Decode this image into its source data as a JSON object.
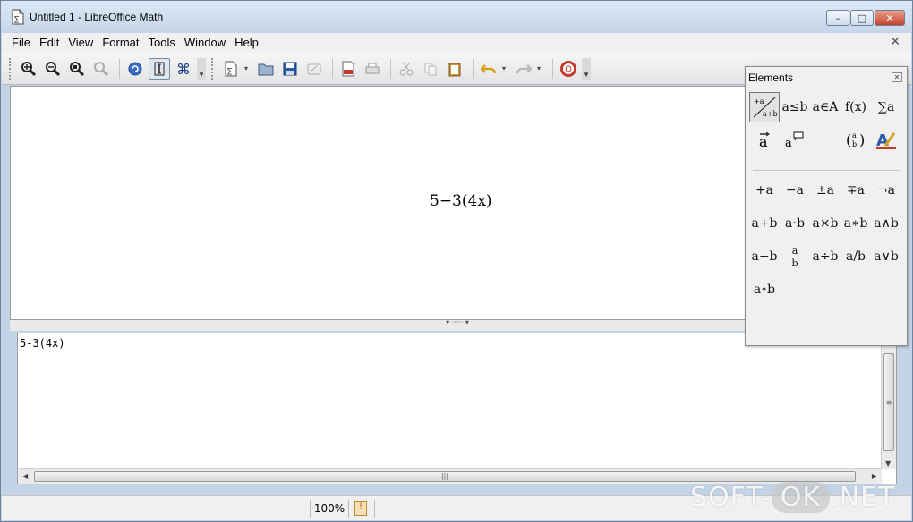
{
  "window": {
    "title": "Untitled 1 - LibreOffice Math",
    "buttons": {
      "minimize": "–",
      "maximize": "□",
      "close": "✕"
    }
  },
  "menu": {
    "items": [
      "File",
      "Edit",
      "View",
      "Format",
      "Tools",
      "Window",
      "Help"
    ],
    "close_doc": "✕"
  },
  "toolbar": {
    "icons": [
      "zoom-in-icon",
      "zoom-out-icon",
      "show-all-icon",
      "zoom-select-icon",
      "update-icon",
      "formula-cursor-icon",
      "symbols-icon",
      "elements-icon",
      "open-icon",
      "save-icon",
      "edit-file-icon",
      "export-pdf-icon",
      "print-icon",
      "cut-icon",
      "copy-icon",
      "paste-icon",
      "undo-icon",
      "redo-icon",
      "help-icon"
    ]
  },
  "preview": {
    "formula": "5−3(4x)"
  },
  "editor": {
    "text": "5-3(4x)"
  },
  "elements_panel": {
    "title": "Elements",
    "categories": [
      "+a/a+b",
      "a≤b",
      "a∈A",
      "f(x)",
      "∑a",
      "a⃗",
      "a💬",
      "(a b)",
      "A✎"
    ],
    "row1": [
      "+a",
      "−a",
      "±a",
      "∓a",
      "¬a"
    ],
    "row2": [
      "a+b",
      "a⋅b",
      "a×b",
      "a∗b",
      "a∧b"
    ],
    "row3": [
      "a−b",
      "a/b-frac",
      "a÷b",
      "a/b",
      "a∨b"
    ],
    "row4": [
      "a∘b"
    ],
    "frac_num": "a",
    "frac_den": "b"
  },
  "status": {
    "zoom": "100%"
  },
  "watermark": {
    "left": "SOFT-",
    "ok": "OK",
    "right": ".NET"
  },
  "colors": {
    "titlebar": "#c4d4e7",
    "close_button": "#c4412b",
    "accent": "#2c4c7c"
  }
}
